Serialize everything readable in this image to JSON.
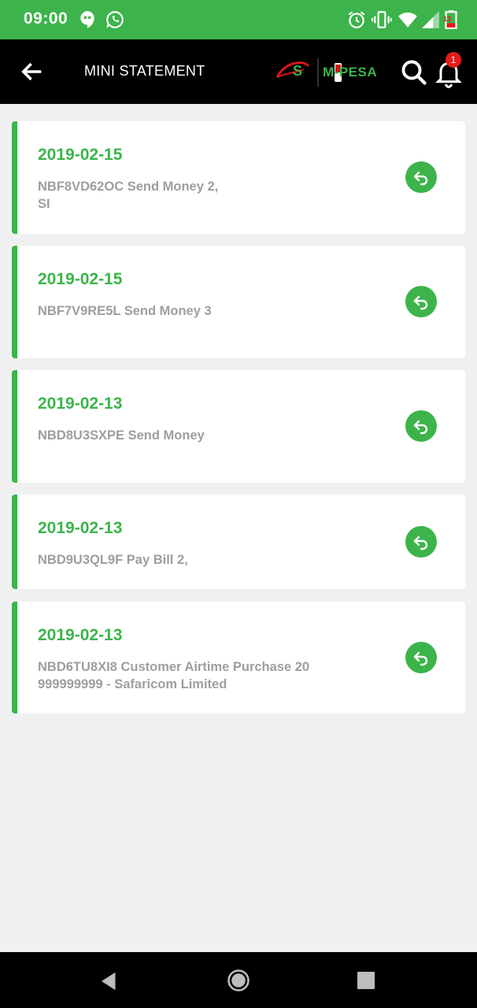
{
  "status_bar": {
    "time": "09:00",
    "battery_level": "13",
    "icons": [
      "hangouts-icon",
      "whatsapp-icon",
      "alarm-icon",
      "vibrate-icon",
      "wifi-icon",
      "signal-icon",
      "battery-icon"
    ]
  },
  "app_bar": {
    "title": "MINI STATEMENT",
    "logo_text": "M-PESA",
    "notification_count": "1"
  },
  "colors": {
    "accent": "#3cb44b",
    "app_bar": "#000000",
    "badge": "#e41b1b",
    "desc_text": "#9e9e9e"
  },
  "transactions": [
    {
      "date": "2019-02-15",
      "description_line1": "NBF8VD62OC Send Money 2,",
      "description_line2": "SI"
    },
    {
      "date": "2019-02-15",
      "description_line1": "NBF7V9RE5L Send Money 3",
      "description_line2": ""
    },
    {
      "date": "2019-02-13",
      "description_line1": "NBD8U3SXPE Send Money",
      "description_line2": ""
    },
    {
      "date": "2019-02-13",
      "description_line1": "NBD9U3QL9F Pay Bill 2,",
      "description_line2": ""
    },
    {
      "date": "2019-02-13",
      "description_line1": "NBD6TU8XI8 Customer Airtime Purchase 20",
      "description_line2": "999999999 - Safaricom Limited"
    }
  ]
}
